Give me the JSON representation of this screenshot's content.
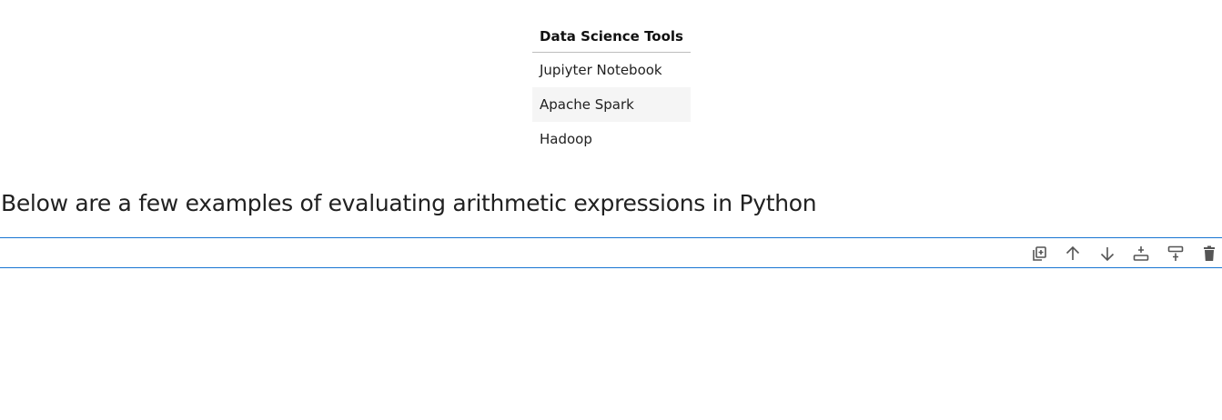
{
  "table": {
    "header": "Data Science Tools",
    "rows": [
      "Jupiyter Notebook",
      "Apache Spark",
      "Hadoop"
    ]
  },
  "heading": "Below are a few examples of evaluating arithmetic expressions in Python",
  "cell_toolbar": {
    "buttons": [
      {
        "icon": "duplicate-icon"
      },
      {
        "icon": "arrow-up-icon"
      },
      {
        "icon": "arrow-down-icon"
      },
      {
        "icon": "insert-below-icon"
      },
      {
        "icon": "insert-above-icon"
      },
      {
        "icon": "delete-icon"
      }
    ]
  },
  "colors": {
    "active_cell_border": "#1976d2",
    "row_stripe": "#f5f5f5",
    "icon": "#555555"
  }
}
